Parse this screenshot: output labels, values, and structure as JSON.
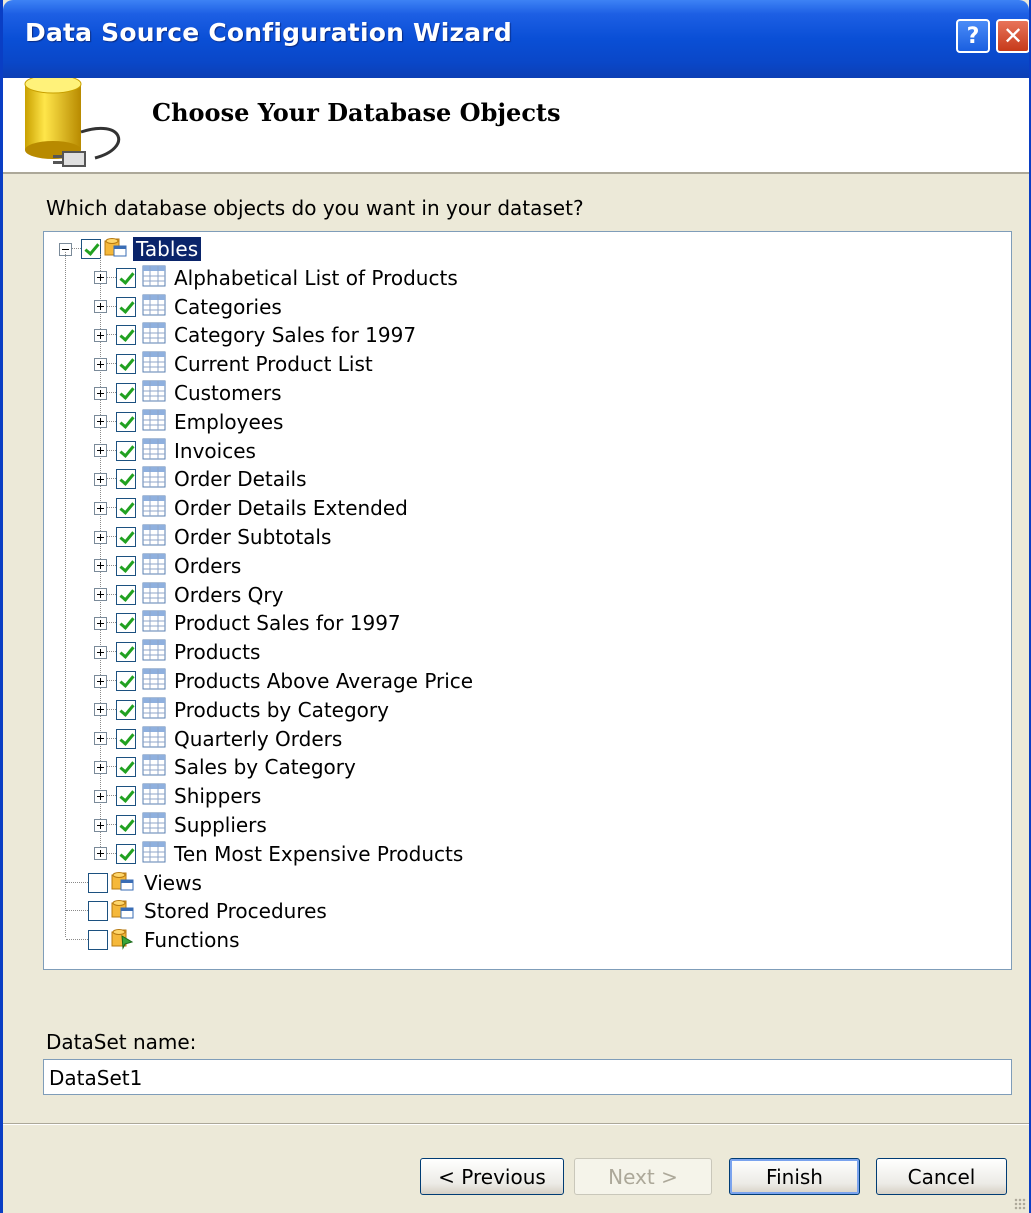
{
  "window": {
    "title": "Data Source Configuration Wizard",
    "help_button": "?",
    "close_button": "✕"
  },
  "header": {
    "title": "Choose Your Database Objects"
  },
  "question": "Which database objects do you want in your dataset?",
  "tree": {
    "root": {
      "label": "Tables",
      "checked": true,
      "expanded": true,
      "selected": true
    },
    "tables": [
      "Alphabetical List of Products",
      "Categories",
      "Category Sales for 1997",
      "Current Product List",
      "Customers",
      "Employees",
      "Invoices",
      "Order Details",
      "Order Details Extended",
      "Order Subtotals",
      "Orders",
      "Orders Qry",
      "Product Sales for 1997",
      "Products",
      "Products Above Average Price",
      "Products by Category",
      "Quarterly Orders",
      "Sales by Category",
      "Shippers",
      "Suppliers",
      "Ten Most Expensive Products"
    ],
    "other_nodes": [
      {
        "label": "Views",
        "checked": false,
        "icon": "views-icon"
      },
      {
        "label": "Stored Procedures",
        "checked": false,
        "icon": "stored-procedures-icon"
      },
      {
        "label": "Functions",
        "checked": false,
        "icon": "functions-icon"
      }
    ]
  },
  "dataset": {
    "label": "DataSet name:",
    "value": "DataSet1"
  },
  "buttons": {
    "previous": "< Previous",
    "next": "Next >",
    "finish": "Finish",
    "cancel": "Cancel"
  },
  "colors": {
    "titlebar": "#0a4fd6",
    "selection": "#0a246a",
    "checkmark": "#21a121",
    "dialog_bg": "#ece9d8"
  }
}
